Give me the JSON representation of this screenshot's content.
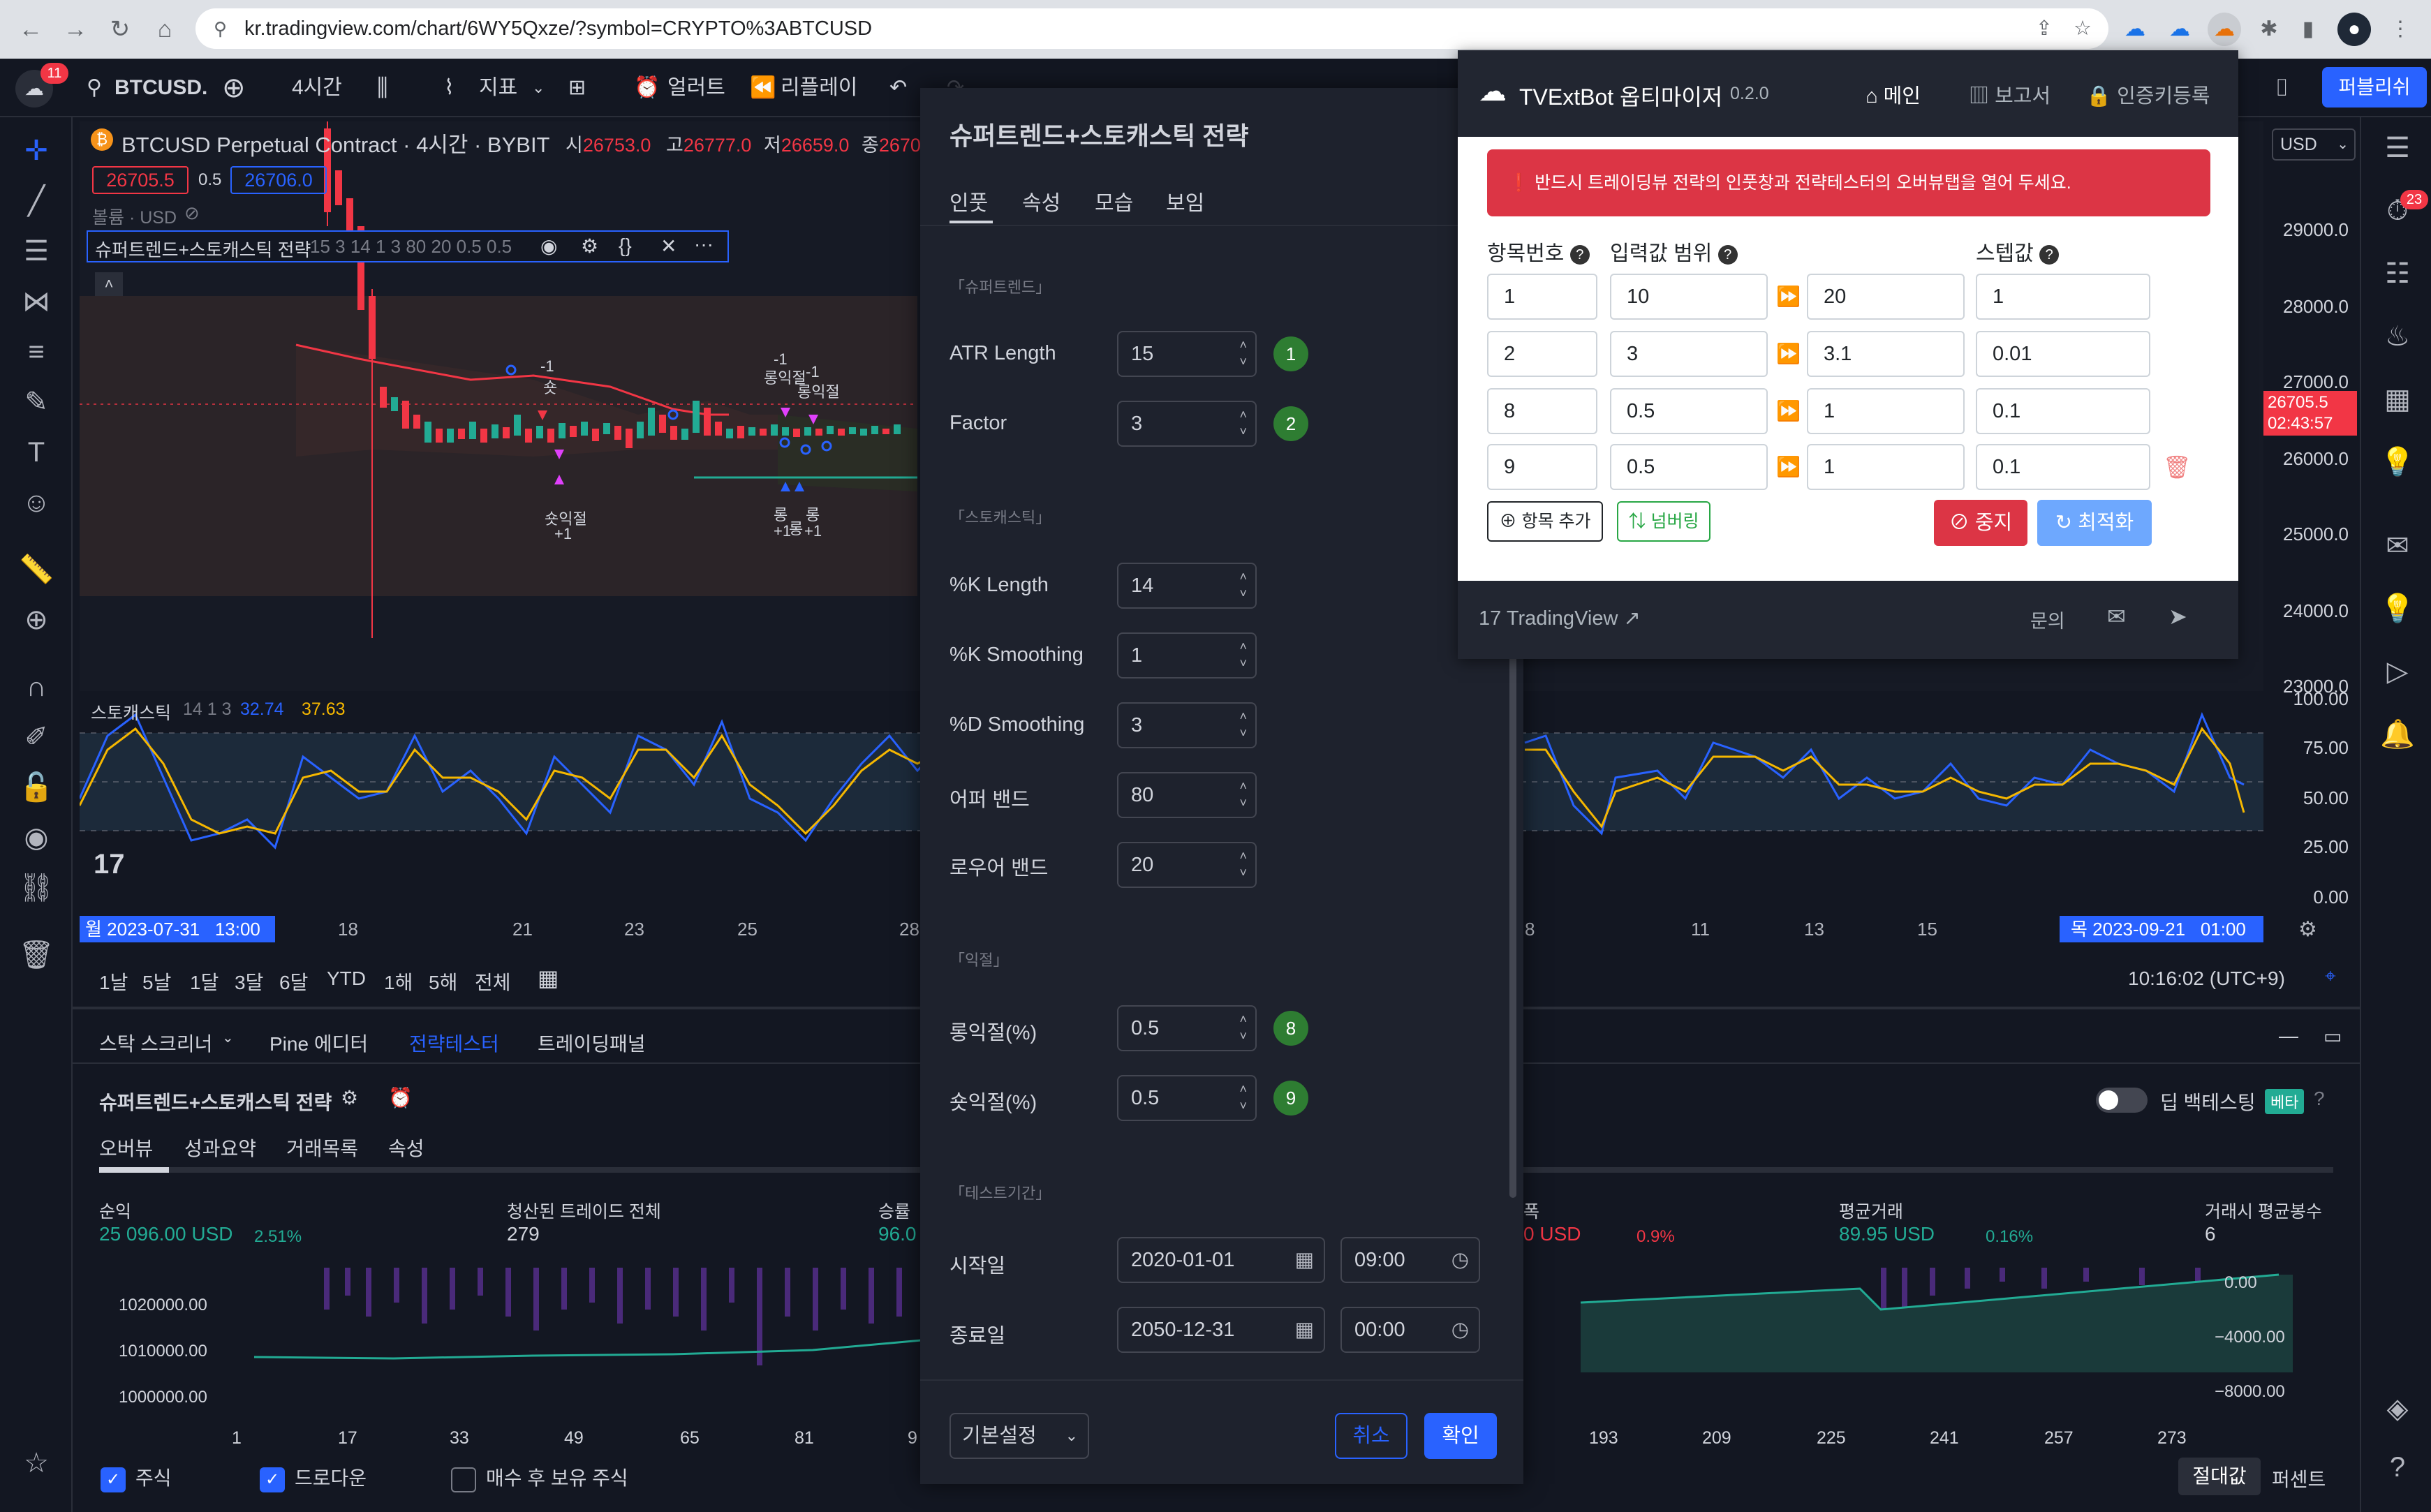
{
  "browser": {
    "url": "kr.tradingview.com/chart/6WY5Qxze/?symbol=CRYPTO%3ABTCUSD"
  },
  "toolbar": {
    "symbol": "BTCUSD.",
    "notif_count": "11",
    "interval": "4시간",
    "indicators": "지표",
    "alerts": "얼러트",
    "replay": "리플레이",
    "publish": "퍼블리쉬"
  },
  "legend": {
    "title": "BTCUSD Perpetual Contract · 4시간 · BYBIT",
    "o_label": "시",
    "o": "26753.0",
    "h_label": "고",
    "h": "26777.0",
    "l_label": "저",
    "l": "26659.0",
    "c_label": "종",
    "c": "2670",
    "bid": "26705.5",
    "spread": "0.5",
    "ask": "26706.0",
    "volume": "볼륨 · USD",
    "strategy": "슈퍼트렌드+스토캐스틱 전략",
    "strategy_params": "15 3 14 1 3 80 20 0.5 0.5"
  },
  "markers": {
    "short": "숏",
    "minus1": "-1",
    "long_tp": "롱익절",
    "short_tp": "숏익절",
    "plus1": "+1",
    "long": "롱"
  },
  "stoch": {
    "name": "스토캐스틱",
    "params": "14 1 3",
    "k": "32.74",
    "d": "37.63"
  },
  "price_scale": {
    "currency": "USD",
    "ticks": [
      "29000.0",
      "28000.0",
      "27000.0",
      "26000.0",
      "25000.0",
      "24000.0",
      "23000.0"
    ],
    "current": "26705.5",
    "countdown": "02:43:57",
    "stoch_ticks": [
      "100.00",
      "75.00",
      "50.00",
      "25.00",
      "0.00"
    ]
  },
  "time_axis": {
    "start": "월 2023-07-31",
    "start_time": "13:00",
    "labels": [
      "18",
      "21",
      "23",
      "25",
      "28",
      "8",
      "11",
      "13",
      "15"
    ],
    "end": "목 2023-09-21",
    "end_time": "01:00"
  },
  "ranges": [
    "1날",
    "5날",
    "1달",
    "3달",
    "6달",
    "YTD",
    "1해",
    "5해",
    "전체"
  ],
  "clock": "10:16:02 (UTC+9)",
  "dock": {
    "tabs": [
      "스탁 스크리너",
      "Pine 에디터",
      "전략테스터",
      "트레이딩패널"
    ],
    "strategy": "슈퍼트렌드+스토캐스틱 전략",
    "subtabs": [
      "오버뷰",
      "성과요약",
      "거래목록",
      "속성"
    ],
    "deep_test": "딥 백테스팅",
    "beta": "베타",
    "stats": [
      {
        "label": "순익",
        "value": "25 096.00 USD",
        "pct": "2.51%"
      },
      {
        "label": "청산된 트레이드 전체",
        "value": "279",
        "pct": ""
      },
      {
        "label": "승률",
        "value": "96.0",
        "pct": ""
      },
      {
        "label": "폭",
        "value": "0 USD",
        "pct": "0.9%"
      },
      {
        "label": "평균거래",
        "value": "89.95 USD",
        "pct": "0.16%"
      },
      {
        "label": "거래시 평균봉수",
        "value": "6",
        "pct": ""
      }
    ],
    "left_ticks": [
      "1020000.00",
      "1010000.00",
      "1000000.00"
    ],
    "right_ticks": [
      "0.00",
      "−4000.00",
      "−8000.00"
    ],
    "x_ticks": [
      "1",
      "17",
      "33",
      "49",
      "65",
      "81",
      "9",
      "193",
      "209",
      "225",
      "241",
      "257",
      "273"
    ],
    "legend_items": [
      "주식",
      "드로다운",
      "매수 후 보유 주식"
    ],
    "abs": "절대값",
    "pct": "퍼센트"
  },
  "dialog": {
    "title": "슈퍼트렌드+스토캐스틱 전략",
    "tabs": [
      "인풋",
      "속성",
      "모습",
      "보임"
    ],
    "sec_st": "「슈퍼트렌드」",
    "sec_stoch": "「스토캐스틱」",
    "sec_tp": "「익절」",
    "sec_period": "「테스트기간」",
    "fields": [
      {
        "label": "ATR Length",
        "value": "15",
        "badge": "1"
      },
      {
        "label": "Factor",
        "value": "3",
        "badge": "2"
      },
      {
        "label": "%K Length",
        "value": "14",
        "badge": ""
      },
      {
        "label": "%K Smoothing",
        "value": "1",
        "badge": ""
      },
      {
        "label": "%D Smoothing",
        "value": "3",
        "badge": ""
      },
      {
        "label": "어퍼 밴드",
        "value": "80",
        "badge": ""
      },
      {
        "label": "로우어 밴드",
        "value": "20",
        "badge": ""
      },
      {
        "label": "롱익절(%)",
        "value": "0.5",
        "badge": "8"
      },
      {
        "label": "숏익절(%)",
        "value": "0.5",
        "badge": "9"
      }
    ],
    "start_label": "시작일",
    "start_date": "2020-01-01",
    "start_time": "09:00",
    "end_label": "종료일",
    "end_date": "2050-12-31",
    "end_time": "00:00",
    "defaults": "기본설정",
    "cancel": "취소",
    "ok": "확인"
  },
  "ext": {
    "name": "TVExtBot 옵티마이저",
    "version": "0.2.0",
    "nav": [
      "메인",
      "보고서",
      "인증키등록"
    ],
    "alert": "반드시 트레이딩뷰 전략의 인풋창과 전략테스터의 오버뷰탭을 열어 두세요.",
    "h_item": "항목번호",
    "h_range": "입력값 범위",
    "h_step": "스텝값",
    "rows": [
      [
        "1",
        "10",
        "20",
        "1"
      ],
      [
        "2",
        "3",
        "3.1",
        "0.01"
      ],
      [
        "8",
        "0.5",
        "1",
        "0.1"
      ],
      [
        "9",
        "0.5",
        "1",
        "0.1"
      ]
    ],
    "add": "항목 추가",
    "renumber": "넘버링",
    "stop": "중지",
    "optimize": "최적화",
    "tv_link": "TradingView",
    "contact": "문의"
  }
}
